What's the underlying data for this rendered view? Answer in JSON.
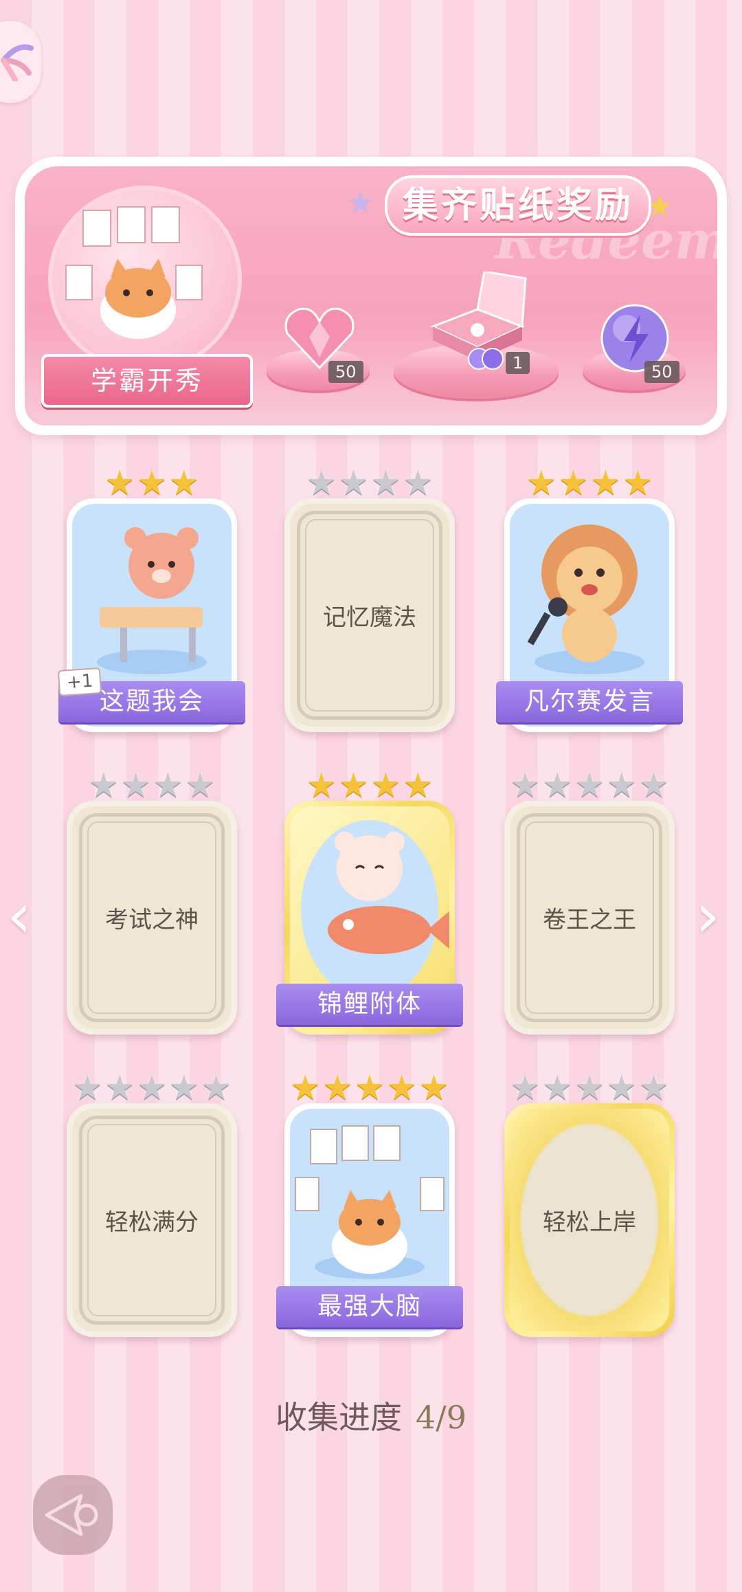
{
  "banner": {
    "title": "集齐贴纸奖励",
    "watermark": "Redeem",
    "featured_label": "学霸开秀",
    "rewards": [
      {
        "name": "heart-gem",
        "count": "50"
      },
      {
        "name": "gift-box",
        "count": "1"
      },
      {
        "name": "energy-orb",
        "count": "50"
      }
    ]
  },
  "cards": [
    {
      "label": "这题我会",
      "stars": 3,
      "filled": 3,
      "state": "unlocked",
      "badge": "+1"
    },
    {
      "label": "记忆魔法",
      "stars": 4,
      "filled": 0,
      "state": "locked"
    },
    {
      "label": "凡尔赛发言",
      "stars": 4,
      "filled": 4,
      "state": "unlocked"
    },
    {
      "label": "考试之神",
      "stars": 4,
      "filled": 0,
      "state": "locked"
    },
    {
      "label": "锦鲤附体",
      "stars": 4,
      "filled": 4,
      "state": "unlocked-gold"
    },
    {
      "label": "卷王之王",
      "stars": 5,
      "filled": 0,
      "state": "locked"
    },
    {
      "label": "轻松满分",
      "stars": 5,
      "filled": 0,
      "state": "locked"
    },
    {
      "label": "最强大脑",
      "stars": 5,
      "filled": 5,
      "state": "unlocked"
    },
    {
      "label": "轻松上岸",
      "stars": 5,
      "filled": 0,
      "state": "locked-gold"
    }
  ],
  "progress": {
    "label": "收集进度",
    "value": "4/9"
  },
  "nav": {
    "prev_glyph": "‹",
    "next_glyph": "›"
  }
}
